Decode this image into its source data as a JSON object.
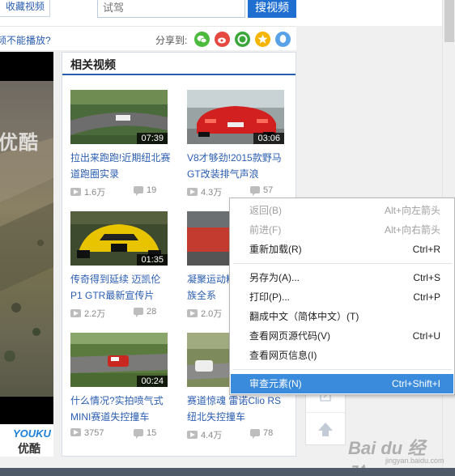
{
  "topbar": {
    "favorite_label": "收藏视频",
    "search_placeholder": "试驾",
    "search_button": "搜视频"
  },
  "share_row": {
    "question": "频不能播放?",
    "share_label": "分享到:",
    "icons": [
      "wechat-icon",
      "weibo-icon",
      "qzone-icon",
      "star-icon",
      "qq-icon"
    ]
  },
  "player": {
    "watermark": "优酷"
  },
  "logo": {
    "en": "YOUKU",
    "zh": "优酷"
  },
  "related": {
    "title": "相关视频",
    "videos": [
      {
        "title": "拉出来跑跑!近期纽北赛道跑圈实录",
        "duration": "07:39",
        "plays": "1.6万",
        "comments": "19"
      },
      {
        "title": "V8才够劲!2015款野马GT改装排气声浪",
        "duration": "03:06",
        "plays": "4.3万",
        "comments": "57"
      },
      {
        "title": "传奇得到延续 迈凯伦P1 GTR最新宣传片",
        "duration": "01:35",
        "plays": "2.2万",
        "comments": "28"
      },
      {
        "title": "凝聚运动精髓 保时捷家族全系",
        "duration": "",
        "plays": "2.0万",
        "comments": ""
      },
      {
        "title": "什么情况?实拍喷气式MINI赛道失控撞车",
        "duration": "00:24",
        "plays": "3757",
        "comments": "15"
      },
      {
        "title": "赛道惊魂 雷诺Clio RS纽北失控撞车",
        "duration": "",
        "plays": "4.4万",
        "comments": "78"
      }
    ]
  },
  "context_menu": {
    "items": [
      {
        "label": "返回(B)",
        "shortcut": "Alt+向左箭头",
        "disabled": true
      },
      {
        "label": "前进(F)",
        "shortcut": "Alt+向右箭头",
        "disabled": true
      },
      {
        "label": "重新加载(R)",
        "shortcut": "Ctrl+R",
        "disabled": false
      },
      {
        "label": "另存为(A)...",
        "shortcut": "Ctrl+S",
        "disabled": false
      },
      {
        "label": "打印(P)...",
        "shortcut": "Ctrl+P",
        "disabled": false
      },
      {
        "label": "翻成中文（简体中文）(T)",
        "shortcut": "",
        "disabled": false
      },
      {
        "label": "查看网页源代码(V)",
        "shortcut": "Ctrl+U",
        "disabled": false
      },
      {
        "label": "查看网页信息(I)",
        "shortcut": "",
        "disabled": false
      },
      {
        "label": "审查元素(N)",
        "shortcut": "Ctrl+Shift+I",
        "disabled": false,
        "highlighted": true
      }
    ]
  },
  "watermark": {
    "text": "Bai du 经验",
    "sub": "jingyan.baidu.com"
  },
  "colors": {
    "link": "#2a5db0",
    "accent": "#1e6fd0",
    "menu_highlight": "#3b8bdc"
  }
}
